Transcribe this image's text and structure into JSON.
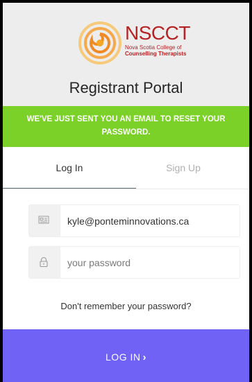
{
  "logo": {
    "name": "NSCCT",
    "line1": "Nova Scotia College of",
    "line2": "Counselling Therapists"
  },
  "portal_title": "Registrant Portal",
  "banner": {
    "line1": "WE'VE JUST SENT YOU AN EMAIL TO RESET YOUR",
    "line2": "PASSWORD."
  },
  "tabs": {
    "login": "Log In",
    "signup": "Sign Up"
  },
  "form": {
    "email_value": "kyle@ponteminnovations.ca",
    "email_icon": "id-card-icon",
    "password_placeholder": "your password",
    "password_icon": "lock-icon"
  },
  "forgot_link": "Don't remember your password?",
  "login_button": {
    "label": "LOG IN",
    "chevron": "›"
  },
  "colors": {
    "banner": "#7bd128",
    "button": "#6f62f5",
    "brand_red": "#b62325",
    "brand_orange": "#f5a623"
  }
}
